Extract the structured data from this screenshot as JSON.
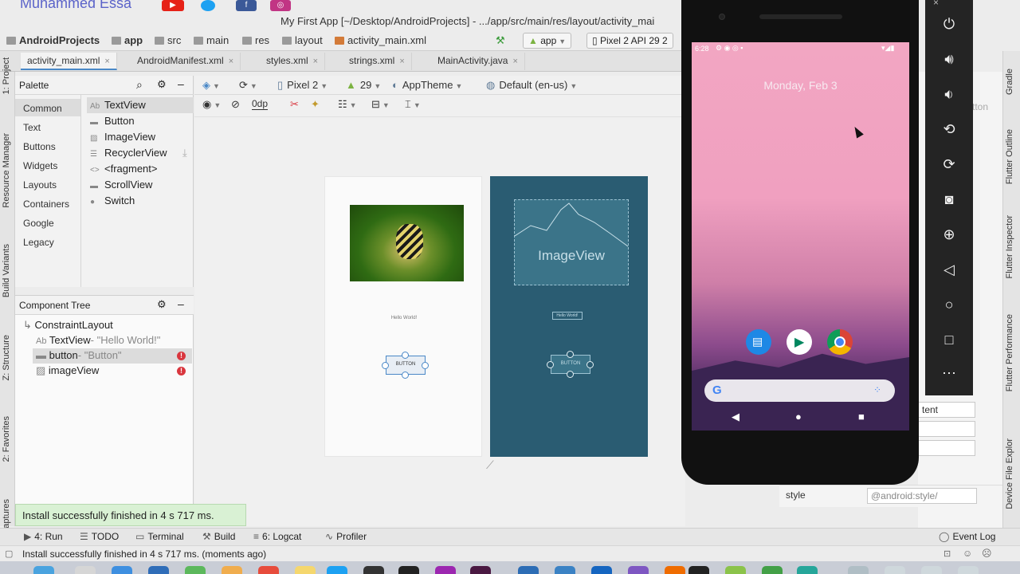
{
  "banner": {
    "author": "Muhammed Essa",
    "socials": [
      "youtube-icon",
      "twitter-icon",
      "facebook-icon",
      "instagram-icon"
    ]
  },
  "window": {
    "title": "My First App [~/Desktop/AndroidProjects] - .../app/src/main/res/layout/activity_mai"
  },
  "breadcrumb": [
    "AndroidProjects",
    "app",
    "src",
    "main",
    "res",
    "layout",
    "activity_main.xml"
  ],
  "run_config": {
    "module": "app",
    "device": "Pixel 2 API 29 2"
  },
  "editor_tabs": [
    {
      "label": "activity_main.xml",
      "active": true
    },
    {
      "label": "AndroidManifest.xml",
      "active": false
    },
    {
      "label": "styles.xml",
      "active": false
    },
    {
      "label": "strings.xml",
      "active": false
    },
    {
      "label": "MainActivity.java",
      "active": false
    }
  ],
  "left_strip": [
    "1: Project",
    "Resource Manager",
    "Build Variants",
    "Z: Structure",
    "2: Favorites",
    "Captures"
  ],
  "right_strip": [
    "Gradle",
    "Flutter Outline",
    "Flutter Inspector",
    "Flutter Performance",
    "Device File Explor"
  ],
  "palette": {
    "title": "Palette",
    "categories": [
      "Common",
      "Text",
      "Buttons",
      "Widgets",
      "Layouts",
      "Containers",
      "Google",
      "Legacy"
    ],
    "selected_category": "Common",
    "items": [
      {
        "icon": "Ab",
        "label": "TextView"
      },
      {
        "icon": "▬",
        "label": "Button"
      },
      {
        "icon": "▨",
        "label": "ImageView"
      },
      {
        "icon": "☰",
        "label": "RecyclerView"
      },
      {
        "icon": "<>",
        "label": "<fragment>"
      },
      {
        "icon": "▬",
        "label": "ScrollView"
      },
      {
        "icon": "●",
        "label": "Switch"
      }
    ]
  },
  "component_tree": {
    "title": "Component Tree",
    "root": "ConstraintLayout",
    "children": [
      {
        "icon": "Ab",
        "name": "TextView",
        "detail": "- \"Hello World!\"",
        "error": false
      },
      {
        "icon": "▬",
        "name": "button",
        "detail": "- \"Button\"",
        "error": true
      },
      {
        "icon": "▨",
        "name": "imageView",
        "detail": "",
        "error": true
      }
    ],
    "error_mark": "!"
  },
  "design_toolbar": {
    "device": "Pixel 2",
    "api": "29",
    "theme": "AppTheme",
    "locale": "Default (en-us)",
    "margin": "0dp"
  },
  "design_preview": {
    "hello_text": "Hello World!",
    "button_text": "BUTTON",
    "imageview_label": "ImageView"
  },
  "attributes": {
    "value_partial": "tent",
    "style_label": "style",
    "style_value": "@android:style/",
    "hint_partial": "tton"
  },
  "toast": "Install successfully finished in 4 s 717 ms.",
  "bottom_tools": [
    {
      "icon": "▶",
      "label": "4: Run"
    },
    {
      "icon": "☰",
      "label": "TODO"
    },
    {
      "icon": "▭",
      "label": "Terminal"
    },
    {
      "icon": "⚒",
      "label": "Build"
    },
    {
      "icon": "≡",
      "label": "6: Logcat"
    },
    {
      "icon": "",
      "label": "Profiler"
    },
    {
      "icon": "◯",
      "label": "Event Log"
    }
  ],
  "status_bar": "Install successfully finished in 4 s 717 ms. (moments ago)",
  "emulator": {
    "time": "6:28",
    "date": "Monday, Feb 3",
    "search_logo": "G",
    "apps": [
      "messages-icon",
      "play-store-icon",
      "chrome-icon"
    ],
    "controls": [
      "power-icon",
      "volume-up-icon",
      "volume-down-icon",
      "rotate-left-icon",
      "rotate-right-icon",
      "camera-icon",
      "zoom-icon",
      "back-icon",
      "home-icon",
      "overview-icon",
      "more-icon"
    ],
    "close": "×"
  },
  "colors": {
    "accent": "#4a88c7",
    "toast_bg": "#d9f1d4",
    "design_dark": "#2a5c72",
    "error": "#d9363e"
  }
}
